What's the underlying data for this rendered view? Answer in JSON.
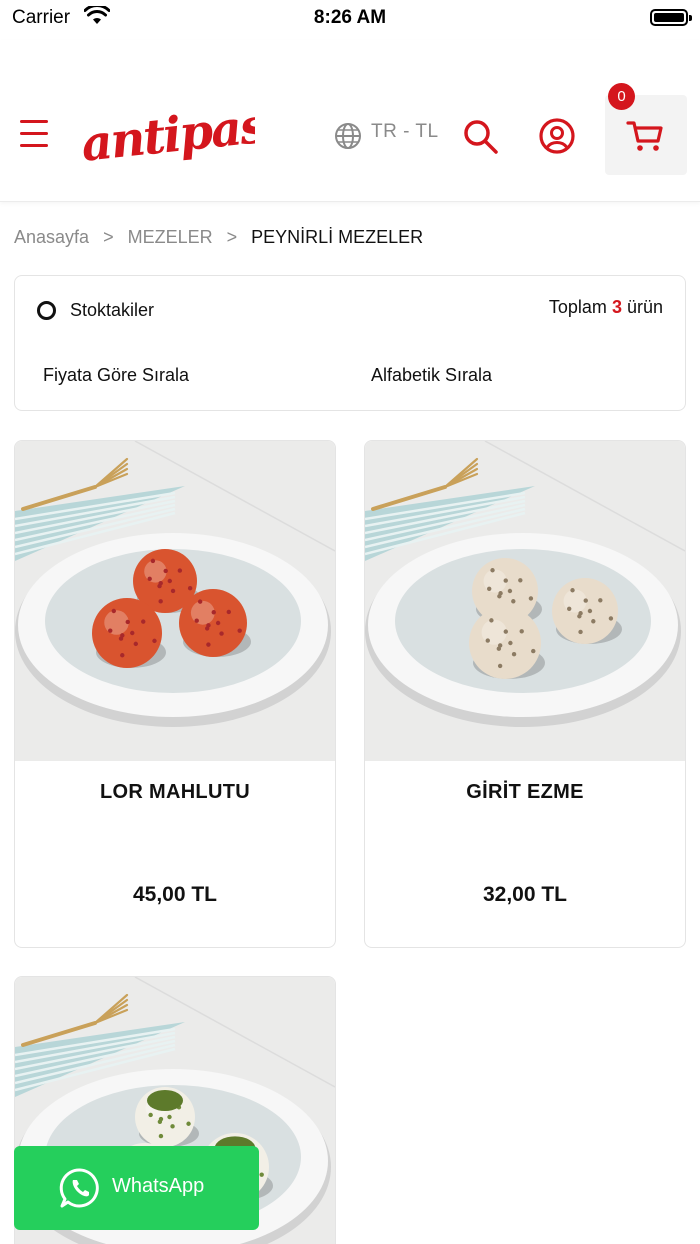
{
  "status_bar": {
    "carrier": "Carrier",
    "time": "8:26 AM"
  },
  "header": {
    "logo_text": "antipasto",
    "language": "TR - TL",
    "cart_count": "0",
    "brand_color": "#d4161d"
  },
  "breadcrumb": {
    "home": "Anasayfa",
    "separator": ">",
    "category": "MEZELER",
    "current": "PEYNİRLİ MEZELER"
  },
  "filters": {
    "in_stock_label": "Stoktakiler",
    "total_prefix": "Toplam",
    "total_count": "3",
    "total_suffix": "ürün",
    "sort_price": "Fiyata Göre Sırala",
    "sort_alpha": "Alfabetik Sırala"
  },
  "products": [
    {
      "name": "LOR MAHLUTU",
      "price": "45,00 TL",
      "ball_color": "#d9542f"
    },
    {
      "name": "GİRİT EZME",
      "price": "32,00 TL",
      "ball_color": "#e8dccb"
    },
    {
      "name": "",
      "price": "",
      "ball_color": "#f2efe6"
    }
  ],
  "whatsapp": {
    "label": "WhatsApp",
    "color": "#25cf5c"
  },
  "icons": [
    "menu-icon",
    "globe-icon",
    "search-icon",
    "user-icon",
    "cart-icon",
    "whatsapp-icon",
    "wifi-icon",
    "battery-icon"
  ]
}
